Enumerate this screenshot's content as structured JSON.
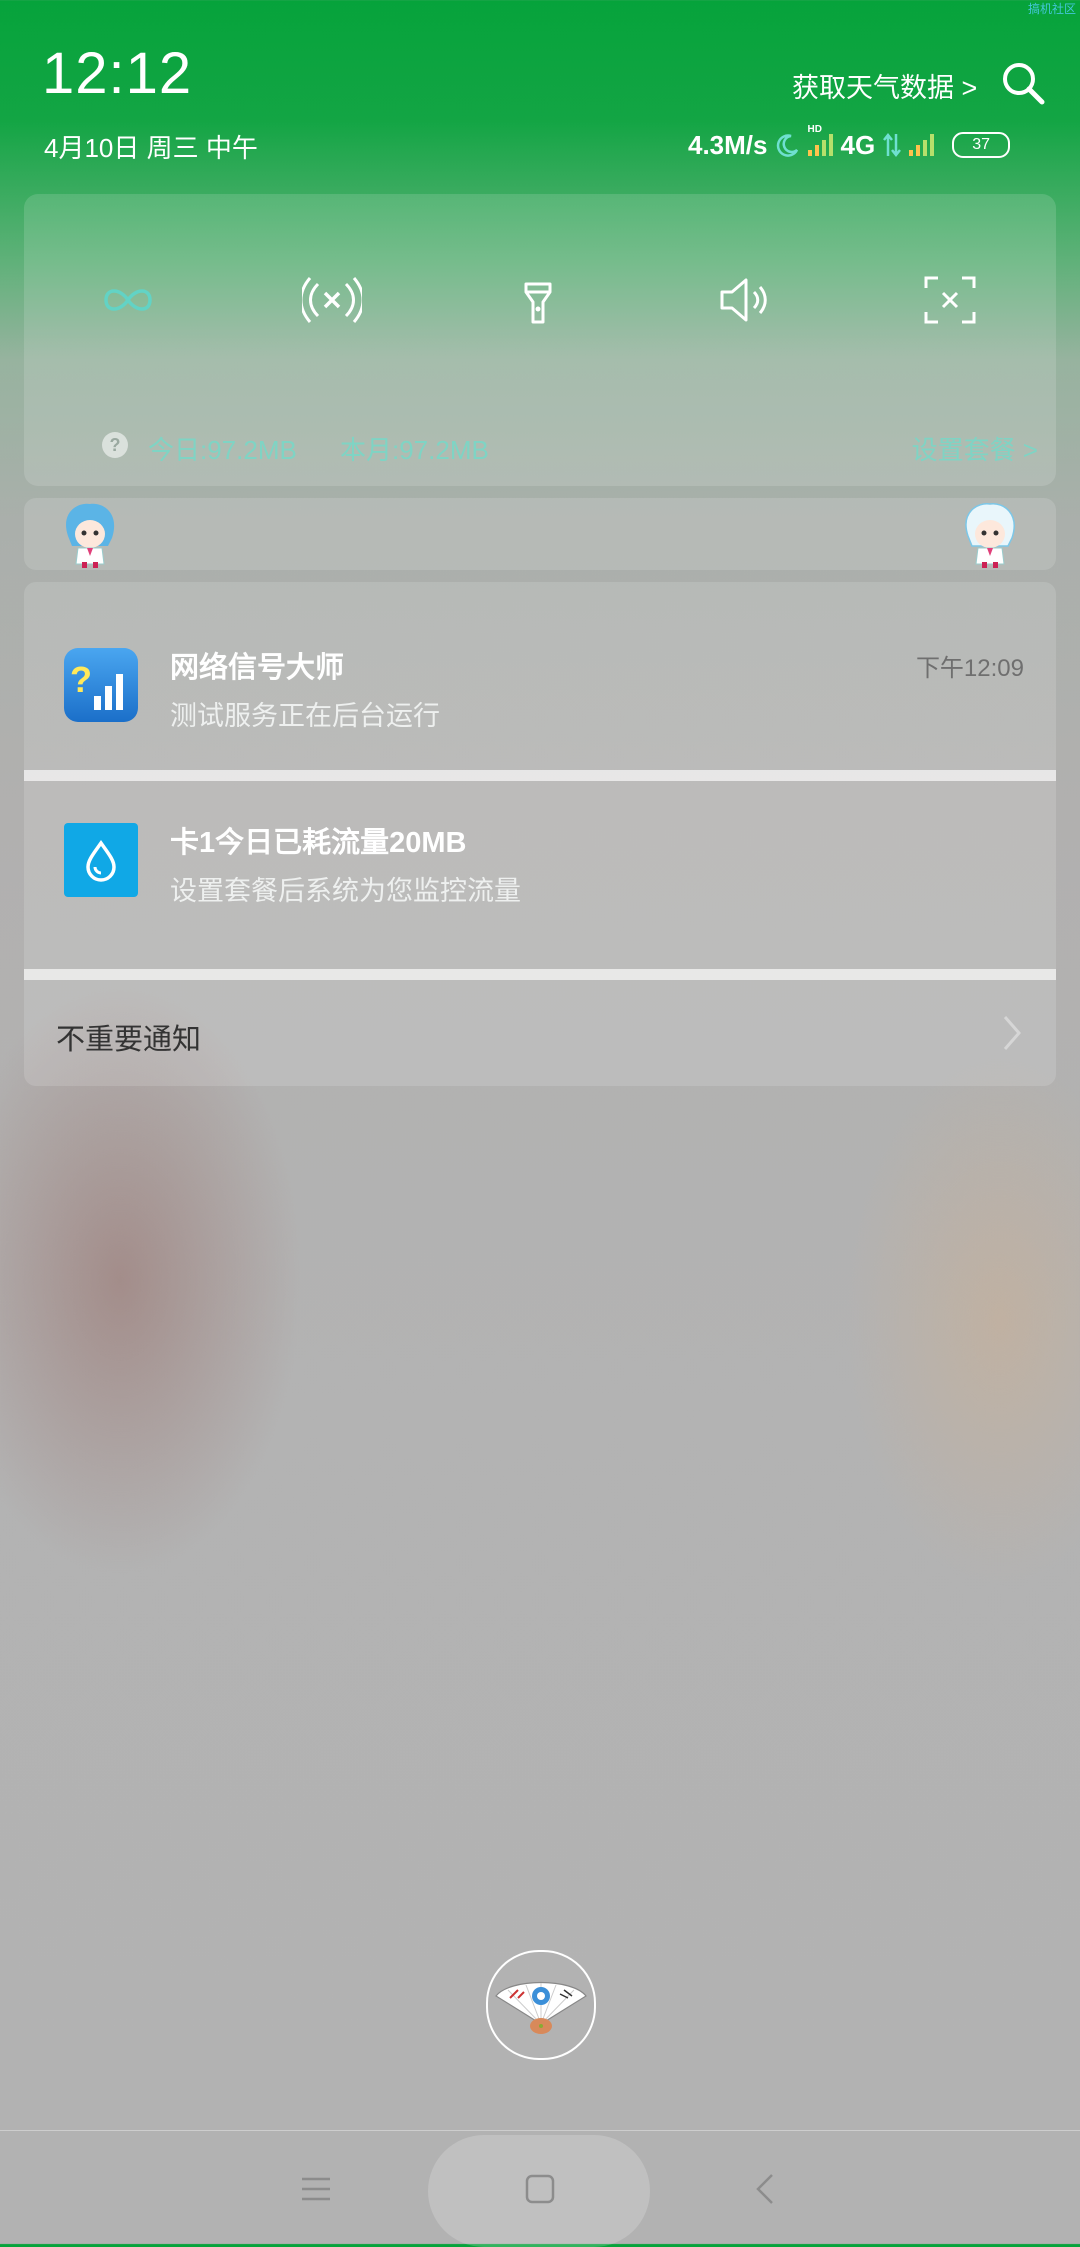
{
  "status": {
    "time": "12:12",
    "date": "4月10日 周三 中午",
    "weather_link": "获取天气数据 >",
    "net_speed": "4.3M/s",
    "hd_label": "HD",
    "network_type": "4G",
    "battery": "37",
    "corner_watermark": "搞机社区"
  },
  "quick_settings": {
    "tiles": [
      "infinity-icon",
      "hotspot-icon",
      "flashlight-icon",
      "sound-icon",
      "screenshot-icon"
    ],
    "help": "?",
    "today_usage": "今日:97.2MB",
    "month_usage": "本月:97.2MB",
    "package_link": "设置套餐 >"
  },
  "notifications": [
    {
      "app_icon": "signal-master-app-icon",
      "title": "网络信号大师",
      "body": "测试服务正在后台运行",
      "time": "下午12:09"
    },
    {
      "app_icon": "data-drop-app-icon",
      "title": "卡1今日已耗流量20MB",
      "body": "设置套餐后系统为您监控流量"
    }
  ],
  "unimportant": {
    "label": "不重要通知"
  },
  "navigation": [
    "menu-icon",
    "home-icon",
    "back-icon"
  ]
}
